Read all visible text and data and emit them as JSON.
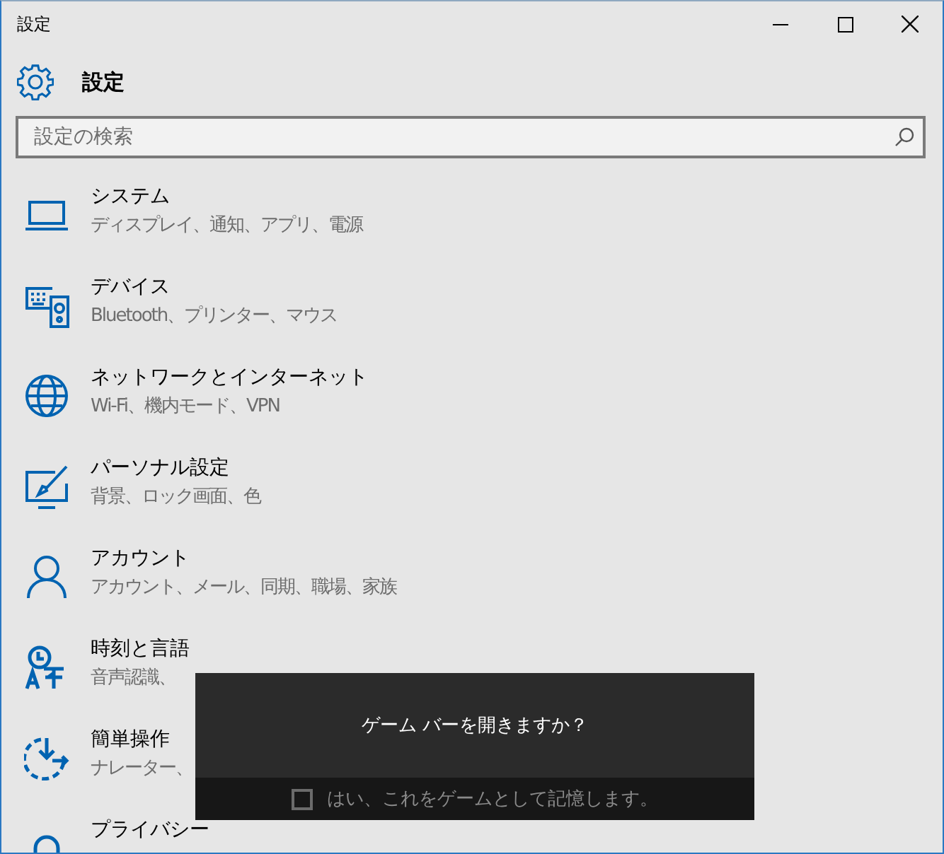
{
  "window": {
    "title": "設定"
  },
  "header": {
    "title": "設定"
  },
  "search": {
    "placeholder": "設定の検索"
  },
  "items": [
    {
      "title": "システム",
      "subtitle": "ディスプレイ、通知、アプリ、電源"
    },
    {
      "title": "デバイス",
      "subtitle": "Bluetooth、プリンター、マウス"
    },
    {
      "title": "ネットワークとインターネット",
      "subtitle": "Wi-Fi、機内モード、VPN"
    },
    {
      "title": "パーソナル設定",
      "subtitle": "背景、ロック画面、色"
    },
    {
      "title": "アカウント",
      "subtitle": "アカウント、メール、同期、職場、家族"
    },
    {
      "title": "時刻と言語",
      "subtitle": "音声認識、"
    },
    {
      "title": "簡単操作",
      "subtitle": "ナレーター、"
    },
    {
      "title": "プライバシー"
    }
  ],
  "dialog": {
    "question": "ゲーム バーを開きますか？",
    "remember": {
      "label": "はい、これをゲームとして記憶します。",
      "checked": false
    }
  }
}
